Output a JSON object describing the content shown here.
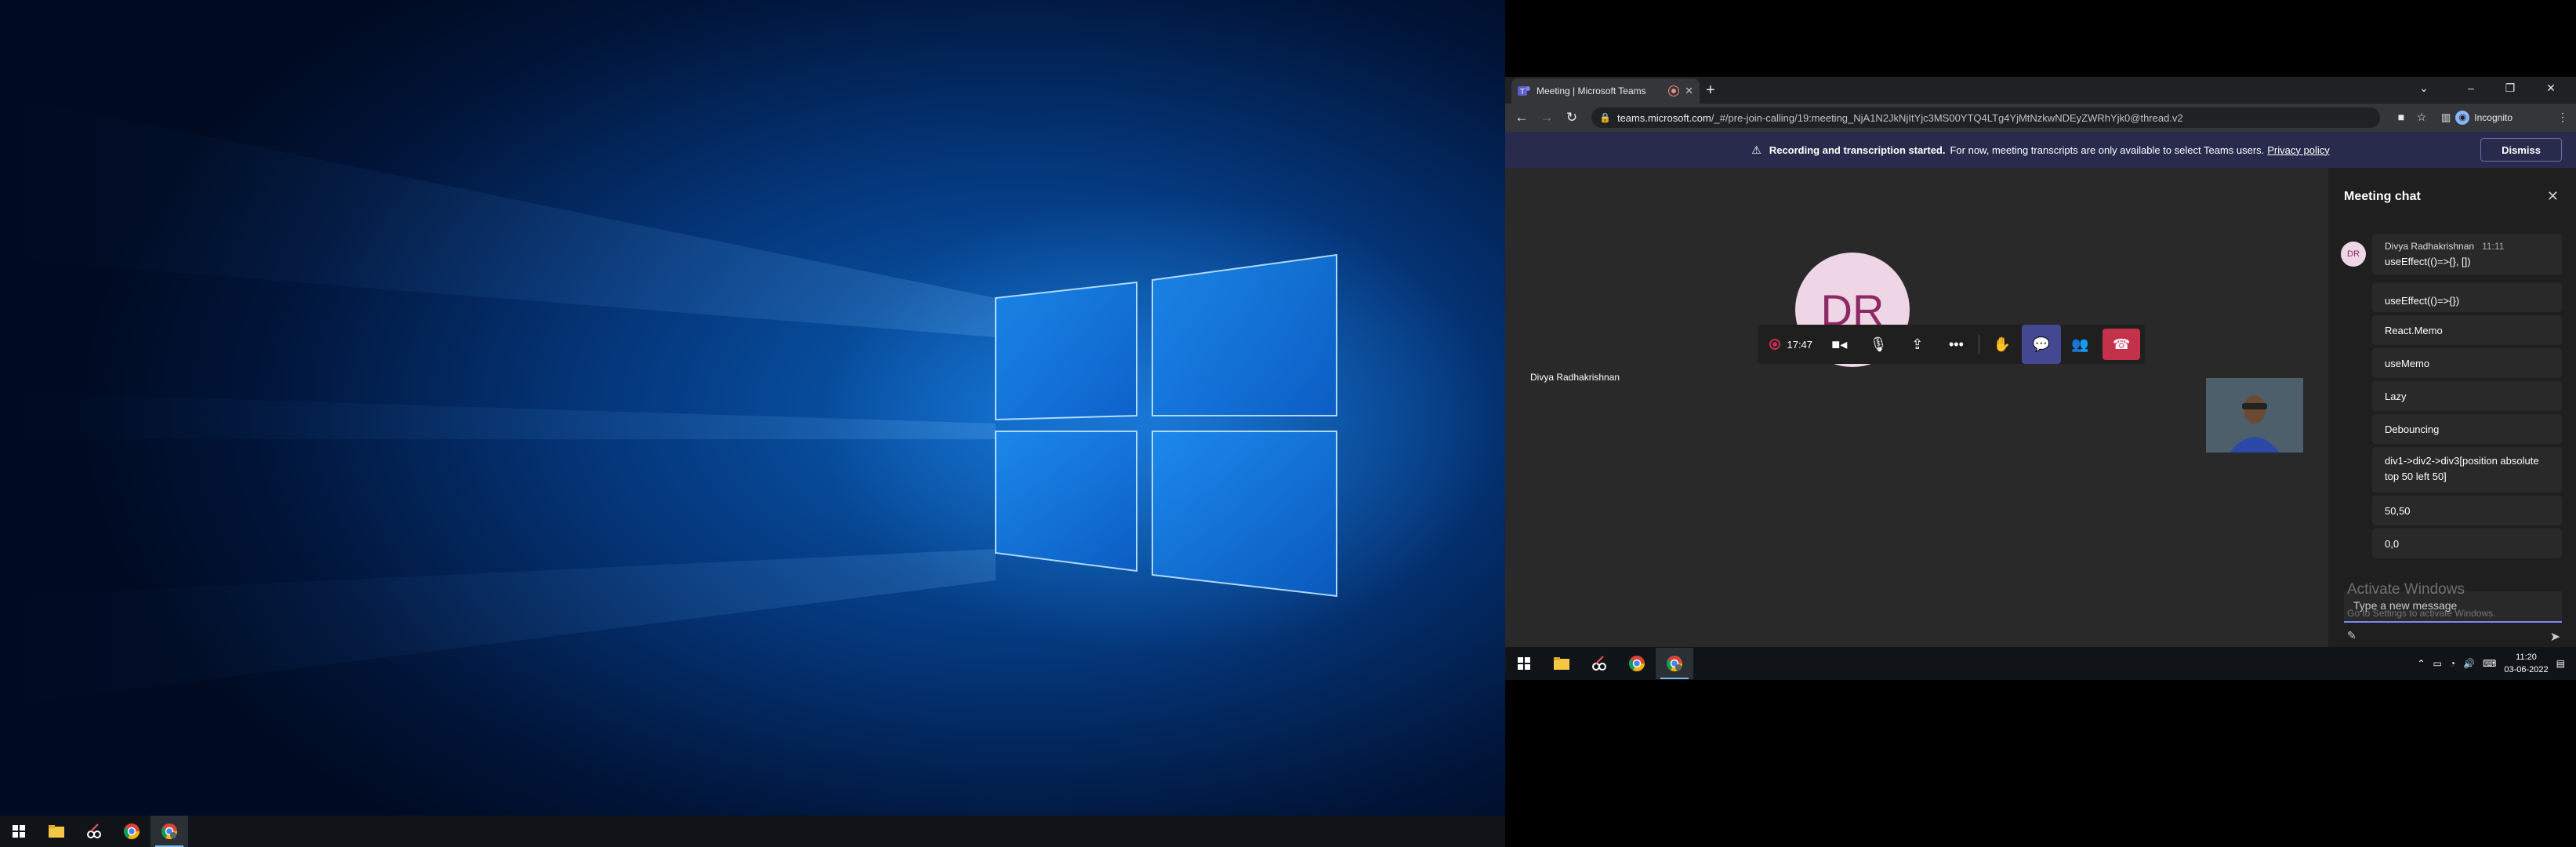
{
  "left_taskbar": {
    "apps": [
      "windows-start",
      "file-explorer",
      "snipping-tool",
      "chrome",
      "chrome-teams"
    ]
  },
  "browser": {
    "tab": {
      "title": "Meeting | Microsoft Teams"
    },
    "new_tab": "+",
    "window_controls": {
      "collapse": "⌄",
      "minimize": "–",
      "maximize": "❐",
      "close": "✕"
    },
    "omnibox": {
      "host": "teams.microsoft.com",
      "path": "/_#/pre-join-calling/19:meeting_NjA1N2JkNjItYjc3MS00YTQ4LTg4YjMtNzkwNDEyZWRhYjk0@thread.v2"
    },
    "incognito_label": "Incognito"
  },
  "teams": {
    "banner": {
      "bold": "Recording and transcription started.",
      "text": "For now, meeting transcripts are only available to select Teams users.",
      "link": "Privacy policy",
      "dismiss": "Dismiss"
    },
    "participant": {
      "initials": "DR",
      "name": "Divya Radhakrishnan"
    },
    "call_bar": {
      "timer": "17:47",
      "buttons": [
        "camera",
        "mic",
        "share",
        "more",
        "raise-hand",
        "chat",
        "people",
        "leave"
      ]
    },
    "chat": {
      "title": "Meeting chat",
      "first": {
        "avatar": "DR",
        "sender": "Divya Radhakrishnan",
        "time": "11:11",
        "text": "useEffect(()=>{}, [])"
      },
      "messages": [
        "useEffect(()=>{})",
        "React.Memo",
        "useMemo",
        "Lazy",
        "Debouncing",
        "div1->div2->div3[position absolute top 50 left 50]",
        "50,50",
        "0,0"
      ],
      "placeholder": "Type a new message",
      "watermark_title": "Activate Windows",
      "watermark_sub": "Go to Settings to activate Windows."
    }
  },
  "right_taskbar": {
    "apps": [
      "windows-start",
      "file-explorer",
      "snipping-tool",
      "chrome",
      "chrome-teams"
    ],
    "time": "11:20",
    "date": "03-06-2022"
  }
}
